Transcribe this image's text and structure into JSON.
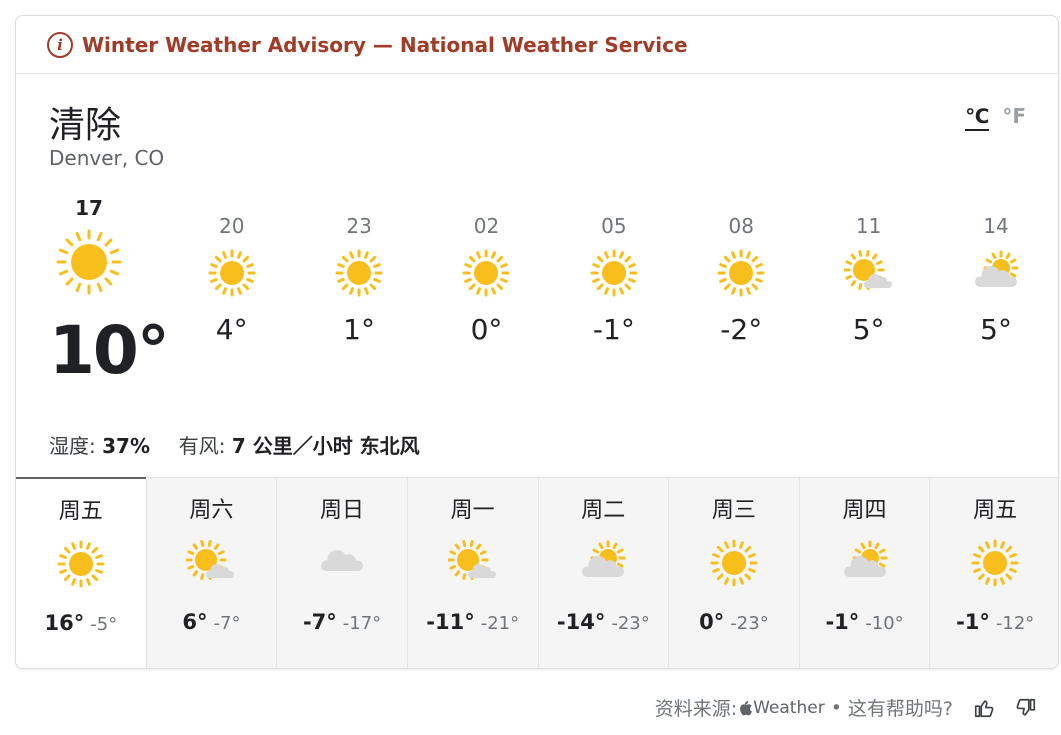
{
  "advisory": {
    "text": "Winter Weather Advisory — National Weather Service",
    "icon": "info-icon",
    "color": "#a03c28"
  },
  "location": {
    "title": "清除",
    "subtitle": "Denver, CO"
  },
  "units": {
    "celsius": "℃",
    "fahrenheit": "°F",
    "selected": "celsius"
  },
  "current": {
    "hour": "17",
    "temp": "10°",
    "icon": "sun"
  },
  "hourly": [
    {
      "hour": "20",
      "temp": "4°",
      "icon": "sun"
    },
    {
      "hour": "23",
      "temp": "1°",
      "icon": "sun"
    },
    {
      "hour": "02",
      "temp": "0°",
      "icon": "sun"
    },
    {
      "hour": "05",
      "temp": "-1°",
      "icon": "sun"
    },
    {
      "hour": "08",
      "temp": "-2°",
      "icon": "sun"
    },
    {
      "hour": "11",
      "temp": "5°",
      "icon": "partly-cloudy"
    },
    {
      "hour": "14",
      "temp": "5°",
      "icon": "mostly-cloudy"
    }
  ],
  "conditions": {
    "humidity_label": "湿度:",
    "humidity_value": "37%",
    "wind_label": "有风:",
    "wind_value": "7 公里／小时 东北风"
  },
  "daily": [
    {
      "day": "周五",
      "high": "16°",
      "low": "-5°",
      "icon": "sun",
      "selected": true
    },
    {
      "day": "周六",
      "high": "6°",
      "low": "-7°",
      "icon": "partly-cloudy",
      "selected": false
    },
    {
      "day": "周日",
      "high": "-7°",
      "low": "-17°",
      "icon": "cloud",
      "selected": false
    },
    {
      "day": "周一",
      "high": "-11°",
      "low": "-21°",
      "icon": "partly-cloudy",
      "selected": false
    },
    {
      "day": "周二",
      "high": "-14°",
      "low": "-23°",
      "icon": "mostly-cloudy",
      "selected": false
    },
    {
      "day": "周三",
      "high": "0°",
      "low": "-23°",
      "icon": "sun",
      "selected": false
    },
    {
      "day": "周四",
      "high": "-1°",
      "low": "-10°",
      "icon": "mostly-cloudy",
      "selected": false
    },
    {
      "day": "周五",
      "high": "-1°",
      "low": "-12°",
      "icon": "sun",
      "selected": false
    }
  ],
  "footer": {
    "source_label": "资料来源:",
    "brand": "Weather",
    "separator": "•",
    "feedback_question": "这有帮助吗?",
    "thumbs_up_icon": "thumbs-up-icon",
    "thumbs_down_icon": "thumbs-down-icon"
  },
  "colors": {
    "sun": "#f8bf1c",
    "cloud": "#d9d9d9",
    "text": "#202124",
    "muted": "#70757a"
  }
}
